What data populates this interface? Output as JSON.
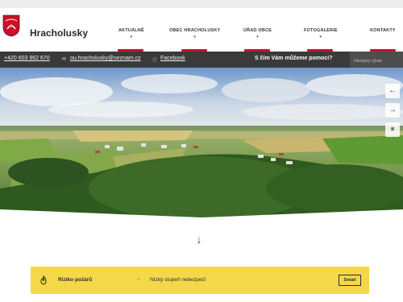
{
  "site": {
    "title": "Hracholusky"
  },
  "nav": {
    "items": [
      {
        "label": "AKTUÁLNĚ"
      },
      {
        "label": "OBEC HRACHOLUSKY"
      },
      {
        "label": "ÚŘAD OBCE"
      },
      {
        "label": "FOTOGALERIE"
      },
      {
        "label": "KONTAKTY"
      }
    ],
    "chevron": "▾"
  },
  "contact": {
    "phone": "+420 603 962 670",
    "email": "ou.hracholusky@seznam.cz",
    "facebook": "Facebook",
    "help_text": "S čím Vám můžeme pomoci?",
    "search_placeholder": "Hledaný výraz"
  },
  "hero": {
    "controls": [
      "←",
      "→",
      "⏸"
    ]
  },
  "scroll": {
    "arrow": "↓"
  },
  "fire_risk": {
    "title": "Riziko požárů",
    "arrow": "→",
    "level": "Nízký stupeň nebezpečí",
    "detail_label": "Detail"
  },
  "colors": {
    "accent": "#c8102e",
    "contact_bar": "#3a3a3a",
    "banner": "#f5d84a"
  }
}
